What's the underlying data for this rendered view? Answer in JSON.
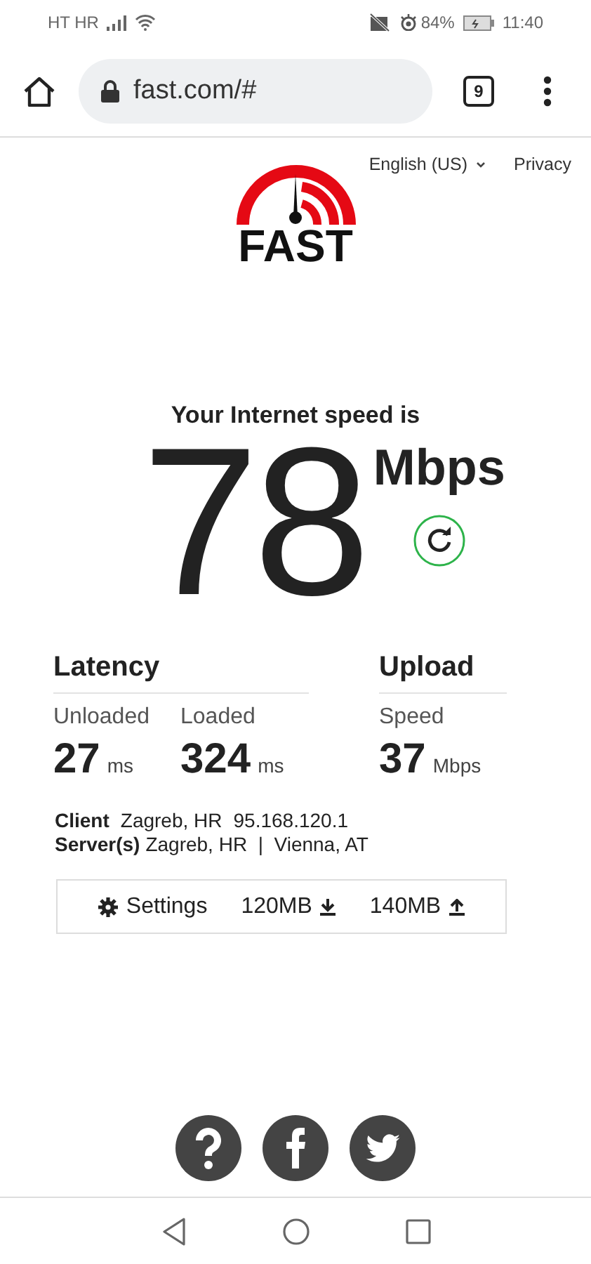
{
  "status_bar": {
    "carrier": "HT HR",
    "battery": "84%",
    "time": "11:40"
  },
  "browser": {
    "url": "fast.com/#",
    "tab_count": "9"
  },
  "header": {
    "logo_text": "FAST",
    "language": "English (US)",
    "privacy": "Privacy"
  },
  "result": {
    "caption": "Your Internet speed is",
    "speed": "78",
    "unit": "Mbps"
  },
  "latency": {
    "title": "Latency",
    "metrics": [
      {
        "label": "Unloaded",
        "value": "27",
        "unit": "ms"
      },
      {
        "label": "Loaded",
        "value": "324",
        "unit": "ms"
      }
    ]
  },
  "upload": {
    "title": "Upload",
    "metrics": [
      {
        "label": "Speed",
        "value": "37",
        "unit": "Mbps"
      }
    ]
  },
  "client": {
    "label": "Client",
    "location": "Zagreb, HR",
    "ip": "95.168.120.1"
  },
  "servers": {
    "label": "Server(s)",
    "list": "Zagreb, HR  |  Vienna, AT"
  },
  "settings_bar": {
    "settings": "Settings",
    "download_size": "120MB",
    "upload_size": "140MB"
  }
}
